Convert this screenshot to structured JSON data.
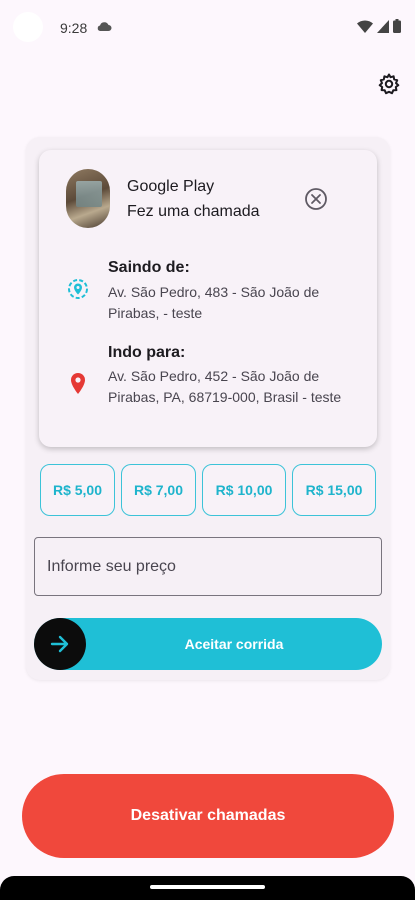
{
  "status_bar": {
    "time": "9:28"
  },
  "caller": {
    "name": "Google Play",
    "action": "Fez uma chamada"
  },
  "pickup": {
    "title": "Saindo de:",
    "address": "Av. São Pedro, 483 - São João de Pirabas,  - teste"
  },
  "dropoff": {
    "title": "Indo para:",
    "address": "Av. São Pedro, 452 - São João de Pirabas, PA, 68719-000, Brasil - teste"
  },
  "prices": [
    "R$ 5,00",
    "R$ 7,00",
    "R$ 10,00",
    "R$ 15,00"
  ],
  "price_input": {
    "placeholder": "Informe seu preço"
  },
  "accept": {
    "label": "Aceitar corrida"
  },
  "deactivate": {
    "label": "Desativar chamadas"
  },
  "icons": {
    "settings": "gear-icon",
    "close": "close-circle-icon",
    "pickup": "my-location-pin-icon",
    "dropoff": "location-pin-icon",
    "accept": "arrow-right-icon"
  },
  "colors": {
    "background": "#fdf7fd",
    "accent": "#1fbfd6",
    "danger": "#f0483c",
    "dropoff_pin": "#e53935"
  }
}
